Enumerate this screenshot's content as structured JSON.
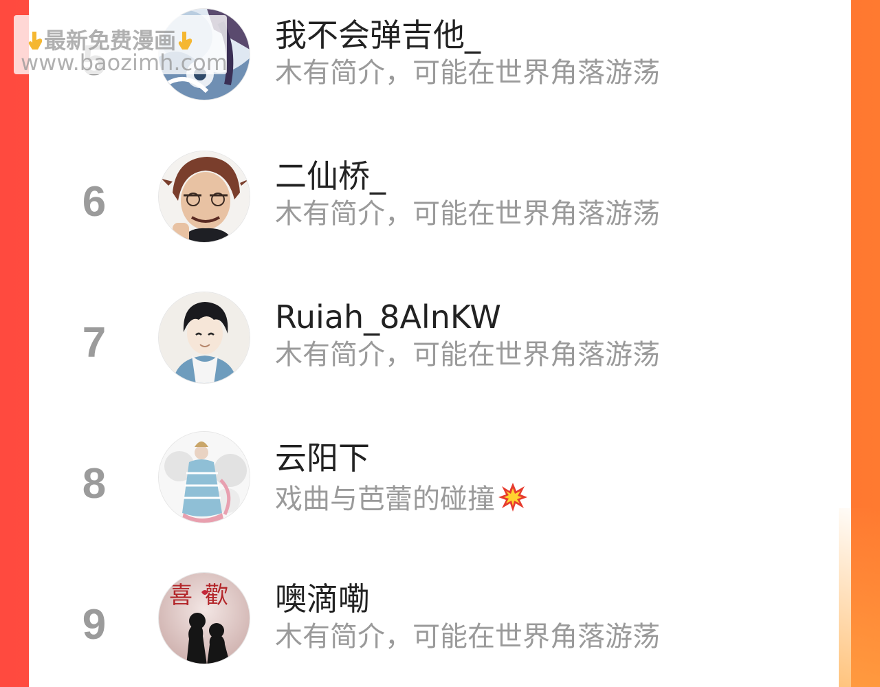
{
  "watermark": {
    "line1": "最新免费漫画",
    "line2": "www.baozimh.com",
    "icon_left": "pointing-down-hand-icon",
    "icon_right": "pointing-down-hand-icon"
  },
  "ranking": {
    "items": [
      {
        "rank": "5",
        "name": "我不会弹吉他_",
        "bio": "木有简介，可能在世界角落游荡",
        "avatar": "anime-avatar-blue"
      },
      {
        "rank": "6",
        "name": "二仙桥_",
        "bio": "木有简介，可能在世界角落游荡",
        "avatar": "anime-avatar-brown-hair"
      },
      {
        "rank": "7",
        "name": "Ruiah_8AlnKW",
        "bio": "木有简介，可能在世界角落游荡",
        "avatar": "anime-avatar-hoodie"
      },
      {
        "rank": "8",
        "name": "云阳下",
        "bio": "戏曲与芭蕾的碰撞",
        "avatar": "illustration-avatar-dress",
        "bio_icon": "collision-icon"
      },
      {
        "rank": "9",
        "name": "噢滴嘞",
        "bio": "木有简介，可能在世界角落游荡",
        "avatar": "silhouette-avatar-couple",
        "avatar_text": "喜歡"
      }
    ]
  },
  "colors": {
    "background_left": "#ff4a3f",
    "background_right": "#ff7a30",
    "card": "#ffffff",
    "rank_gray": "#9b9b9b",
    "name_text": "#222222",
    "bio_text": "#9a9a9a"
  }
}
